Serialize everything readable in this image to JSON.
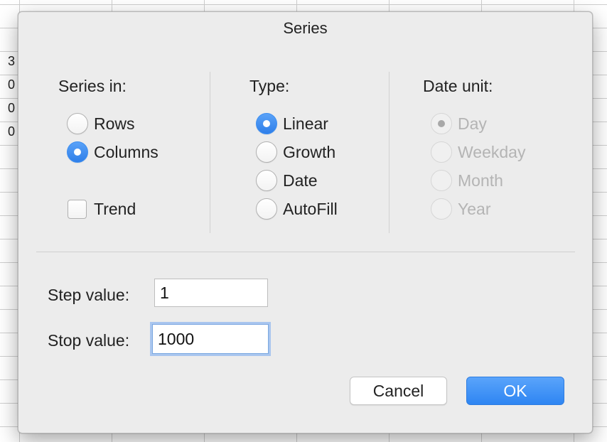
{
  "spreadsheet": {
    "visible_cells": [
      "3",
      "0",
      "0",
      "0"
    ]
  },
  "dialog": {
    "title": "Series",
    "series_in": {
      "label": "Series in:",
      "options": [
        "Rows",
        "Columns"
      ],
      "selected": "Columns"
    },
    "trend": {
      "label": "Trend",
      "checked": false
    },
    "type": {
      "label": "Type:",
      "options": [
        "Linear",
        "Growth",
        "Date",
        "AutoFill"
      ],
      "selected": "Linear"
    },
    "date_unit": {
      "label": "Date unit:",
      "options": [
        "Day",
        "Weekday",
        "Month",
        "Year"
      ],
      "selected": "Day",
      "enabled": false
    },
    "step_value": {
      "label": "Step value:",
      "value": "1"
    },
    "stop_value": {
      "label": "Stop value:",
      "value": "1000"
    },
    "buttons": {
      "cancel": "Cancel",
      "ok": "OK"
    },
    "colors": {
      "accent": "#3a8df5",
      "dialog_bg": "#ececec",
      "disabled_text": "#b4b4b4"
    }
  }
}
